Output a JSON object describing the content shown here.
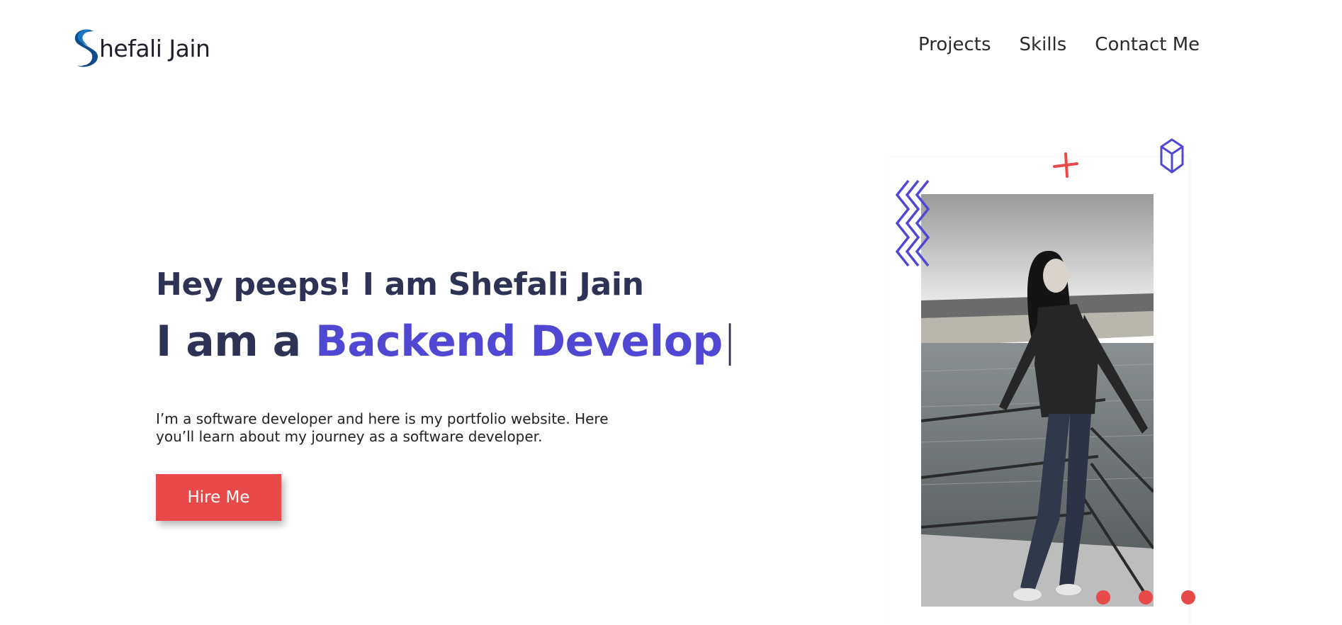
{
  "logo": {
    "text": "hefali Jain",
    "icon": "s-swirl-logo-icon"
  },
  "nav": {
    "items": [
      "Projects",
      "Skills",
      "Contact Me"
    ]
  },
  "hero": {
    "greeting": "Hey peeps! I am Shefali Jain",
    "role_prefix": "I am a ",
    "role_typed": "Backend Develop",
    "cursor": "|",
    "description": "I’m a software developer and here is my portfolio website. Here you’ll learn about my journey as a software developer.",
    "cta_label": "Hire Me"
  },
  "colors": {
    "accent": "#5048d2",
    "cta": "#e84a4a",
    "heading": "#2e3356"
  },
  "decorations": [
    "zigzag-icon",
    "plus-icon",
    "cube-icon",
    "dots-pattern"
  ]
}
